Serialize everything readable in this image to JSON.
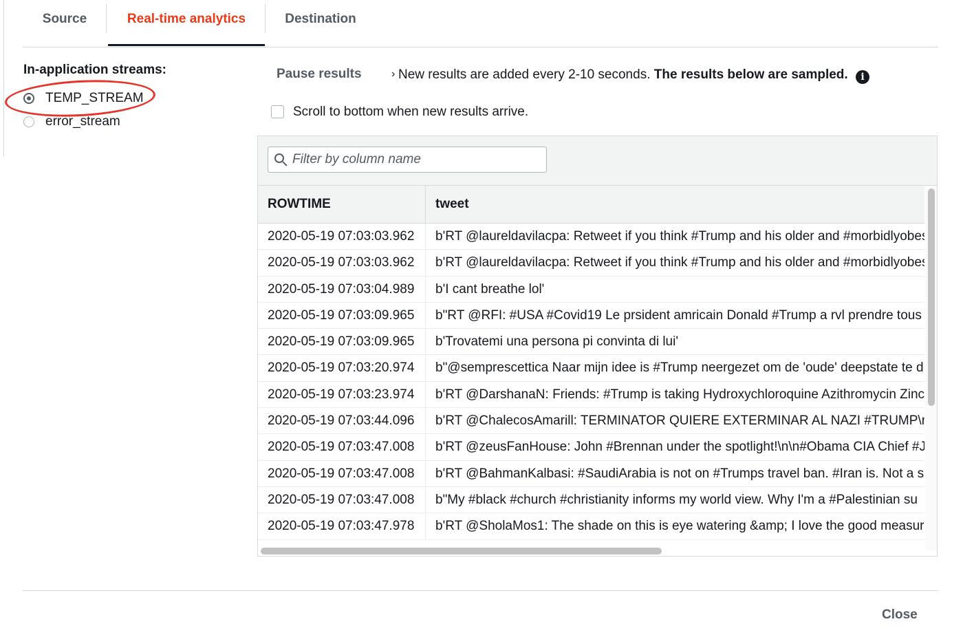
{
  "tabs": [
    {
      "label": "Source"
    },
    {
      "label": "Real-time analytics",
      "active": true
    },
    {
      "label": "Destination"
    }
  ],
  "streams": {
    "title": "In-application streams:",
    "options": [
      {
        "label": "TEMP_STREAM",
        "selected": true
      },
      {
        "label": "error_stream",
        "selected": false
      }
    ]
  },
  "controls": {
    "pause_label": "Pause results",
    "spinner_glyph": "›",
    "info_text": "New results are added every 2-10 seconds.",
    "info_bold": "The results below are sampled.",
    "info_icon": "i",
    "scroll_label": "Scroll to bottom when new results arrive.",
    "scroll_checked": false
  },
  "filter": {
    "placeholder": "Filter by column name"
  },
  "table": {
    "columns": [
      "ROWTIME",
      "tweet"
    ],
    "rows": [
      [
        "2020-05-19 07:03:03.962",
        "b'RT @laureldavilacpa: Retweet if you think #Trump and his older and #morbidlyobese"
      ],
      [
        "2020-05-19 07:03:03.962",
        "b'RT @laureldavilacpa: Retweet if you think #Trump and his older and #morbidlyobese"
      ],
      [
        "2020-05-19 07:03:04.989",
        "b'I cant breathe lol'"
      ],
      [
        "2020-05-19 07:03:09.965",
        "b\"RT @RFI: #USA #Covid19 Le prsident amricain Donald #Trump a rvl prendre tous"
      ],
      [
        "2020-05-19 07:03:09.965",
        "b'Trovatemi una persona pi convinta di lui'"
      ],
      [
        "2020-05-19 07:03:20.974",
        "b\"@semprescettica Naar mijn idee is #Trump neergezet om de 'oude' deepstate te d"
      ],
      [
        "2020-05-19 07:03:23.974",
        "b'RT @DarshanaN: Friends: #Trump is taking Hydroxychloroquine Azithromycin Zinc"
      ],
      [
        "2020-05-19 07:03:44.096",
        "b'RT @ChalecosAmarill: TERMINATOR QUIERE EXTERMINAR AL NAZI #TRUMP\\n\\n"
      ],
      [
        "2020-05-19 07:03:47.008",
        "b'RT @zeusFanHouse: John #Brennan under the spotlight!\\n\\n#Obama CIA Chief #J"
      ],
      [
        "2020-05-19 07:03:47.008",
        "b'RT @BahmanKalbasi: #SaudiArabia is not on #Trumps travel ban. #Iran is. Not a si"
      ],
      [
        "2020-05-19 07:03:47.008",
        "b\"My #black #church #christianity informs my world view. Why I'm a #Palestinian su"
      ],
      [
        "2020-05-19 07:03:47.978",
        "b'RT @SholaMos1: The shade on this is eye watering &amp; I love the good measur"
      ]
    ]
  },
  "footer": {
    "close_label": "Close"
  },
  "colors": {
    "active_tab": "#ec3a17",
    "annotation": "#e5352a",
    "text": "#16191f",
    "muted": "#545b64"
  }
}
